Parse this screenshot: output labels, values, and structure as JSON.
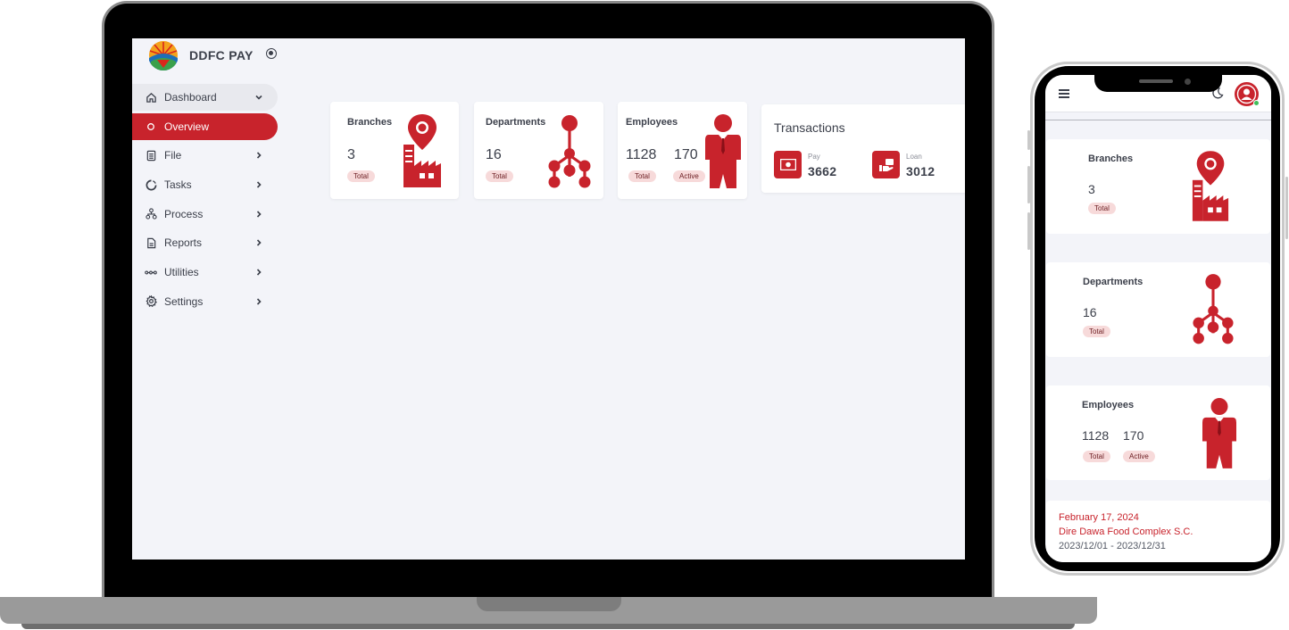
{
  "brand": {
    "name": "DDFC PAY"
  },
  "sidebar": {
    "items": [
      {
        "label": "Dashboard"
      },
      {
        "label": "Overview"
      },
      {
        "label": "File"
      },
      {
        "label": "Tasks"
      },
      {
        "label": "Process"
      },
      {
        "label": "Reports"
      },
      {
        "label": "Utilities"
      },
      {
        "label": "Settings"
      }
    ]
  },
  "cards": {
    "branches": {
      "title": "Branches",
      "total": "3",
      "total_label": "Total"
    },
    "departments": {
      "title": "Departments",
      "total": "16",
      "total_label": "Total"
    },
    "employees": {
      "title": "Employees",
      "total": "1128",
      "total_label": "Total",
      "active": "170",
      "active_label": "Active"
    },
    "transactions": {
      "title": "Transactions",
      "pay_label": "Pay",
      "pay_value": "3662",
      "loan_label": "Loan",
      "loan_value": "3012"
    }
  },
  "footer": {
    "date": "February 17, 2024",
    "company": "Dire Dawa Food Complex S.C.",
    "period": "2023/12/01 - 2023/12/31"
  },
  "colors": {
    "accent": "#c8232c",
    "background": "#f3f4f9",
    "text": "#3b3f4a"
  },
  "icons": [
    "home-icon",
    "circle-icon",
    "file-icon",
    "spinner-icon",
    "process-icon",
    "report-icon",
    "utilities-icon",
    "gear-icon",
    "chevron-right-icon",
    "chevron-down-icon",
    "location-factory-icon",
    "org-tree-icon",
    "employee-icon",
    "money-icon",
    "loan-hand-icon",
    "menu-icon",
    "moon-icon",
    "avatar-icon"
  ]
}
